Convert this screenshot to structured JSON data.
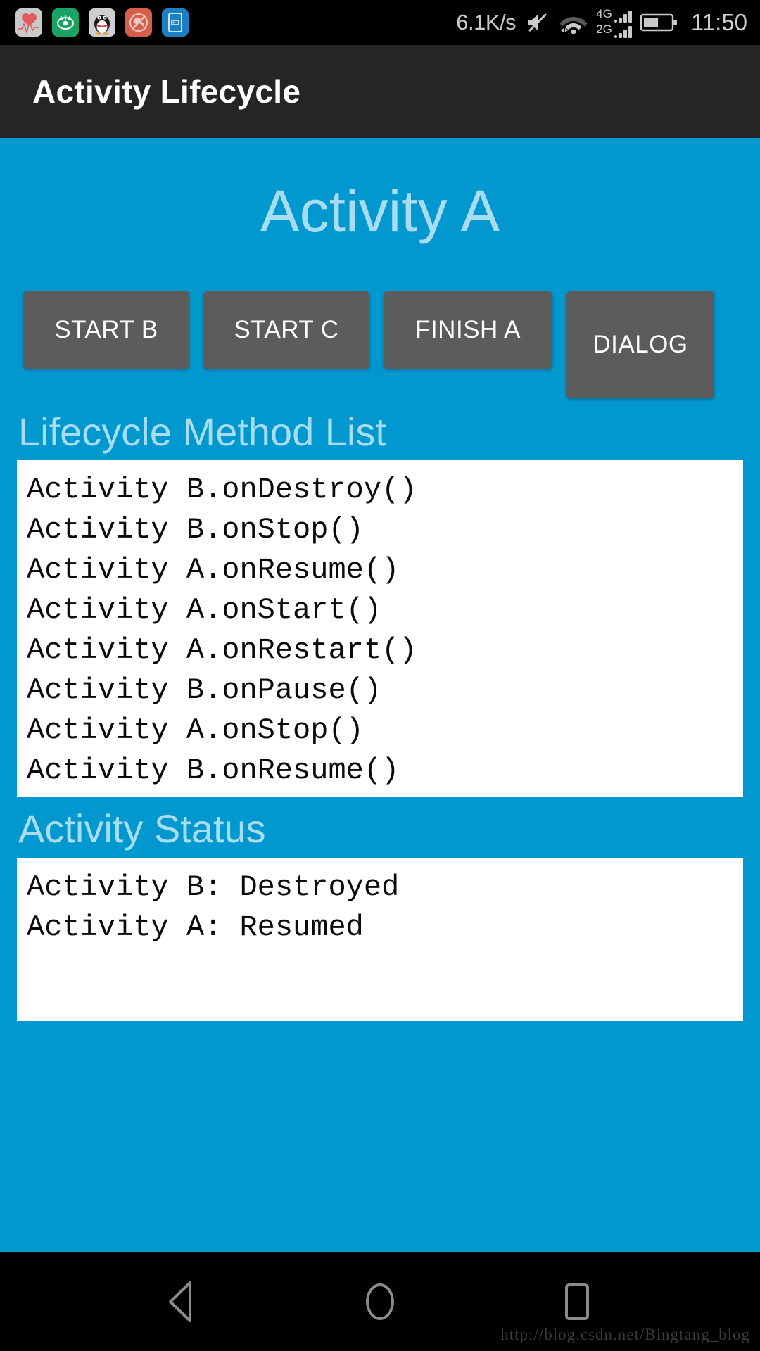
{
  "status_bar": {
    "notification_icons": [
      {
        "name": "health-heart-icon",
        "label": "Health"
      },
      {
        "name": "eye-icon",
        "label": "Eye Care"
      },
      {
        "name": "qq-penguin-icon",
        "label": "QQ"
      },
      {
        "name": "tools-blocked-icon",
        "label": "Tools"
      },
      {
        "name": "card-reader-icon",
        "label": "Card"
      }
    ],
    "network_speed": "6.1K/s",
    "mute_icon": "mute-icon",
    "wifi_icon": "wifi-icon",
    "sim1_label": "4G",
    "sim2_label": "2G",
    "battery_icon": "battery-icon",
    "clock": "11:50"
  },
  "action_bar": {
    "title": "Activity Lifecycle"
  },
  "main": {
    "heading": "Activity A",
    "buttons": [
      {
        "id": "start-b",
        "label": "START B"
      },
      {
        "id": "start-c",
        "label": "START C"
      },
      {
        "id": "finish-a",
        "label": "FINISH A"
      },
      {
        "id": "dialog",
        "label": "DIALOG"
      }
    ],
    "method_list": {
      "label": "Lifecycle Method List",
      "entries": [
        "Activity B.onDestroy()",
        "Activity B.onStop()",
        "Activity A.onResume()",
        "Activity A.onStart()",
        "Activity A.onRestart()",
        "Activity B.onPause()",
        "Activity A.onStop()",
        "Activity B.onResume()"
      ]
    },
    "activity_status": {
      "label": "Activity Status",
      "entries": [
        "Activity B: Destroyed",
        "Activity A: Resumed"
      ]
    }
  },
  "nav_bar": {
    "back_icon": "back-triangle-icon",
    "home_icon": "home-circle-icon",
    "recents_icon": "recents-square-icon"
  },
  "watermark": "http://blog.csdn.net/Bingtang_blog",
  "colors": {
    "background": "#0098ce",
    "accent_text": "#a8dcf0",
    "button": "#5c5c5c",
    "action_bar": "#252525",
    "panel": "#ffffff"
  }
}
